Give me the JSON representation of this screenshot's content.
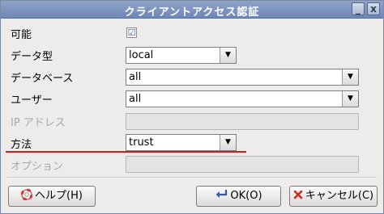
{
  "window": {
    "title": "クライアントアクセス認証",
    "controls": [
      "_",
      "x"
    ]
  },
  "form": {
    "enabled_label": "可能",
    "enabled_value": "☑",
    "datatype_label": "データ型",
    "datatype_value": "local",
    "database_label": "データベース",
    "database_value": "all",
    "user_label": "ユーザー",
    "user_value": "all",
    "ip_label": "IP アドレス",
    "method_label": "方法",
    "method_value": "trust",
    "option_label": "オプション",
    "dropdown_arrow": "▼"
  },
  "buttons": {
    "help_label": "ヘルプ(H)",
    "ok_label": "OK(O)",
    "cancel_label": "キャンセル(C)"
  },
  "icons": {
    "help": "lifebuoy-icon",
    "ok": "arrow-return-icon",
    "cancel": "cross-icon"
  },
  "colors": {
    "titlebar": "#7a90bd",
    "highlight_underline": "#d01c1c",
    "cancel_icon": "#d02a1a"
  }
}
